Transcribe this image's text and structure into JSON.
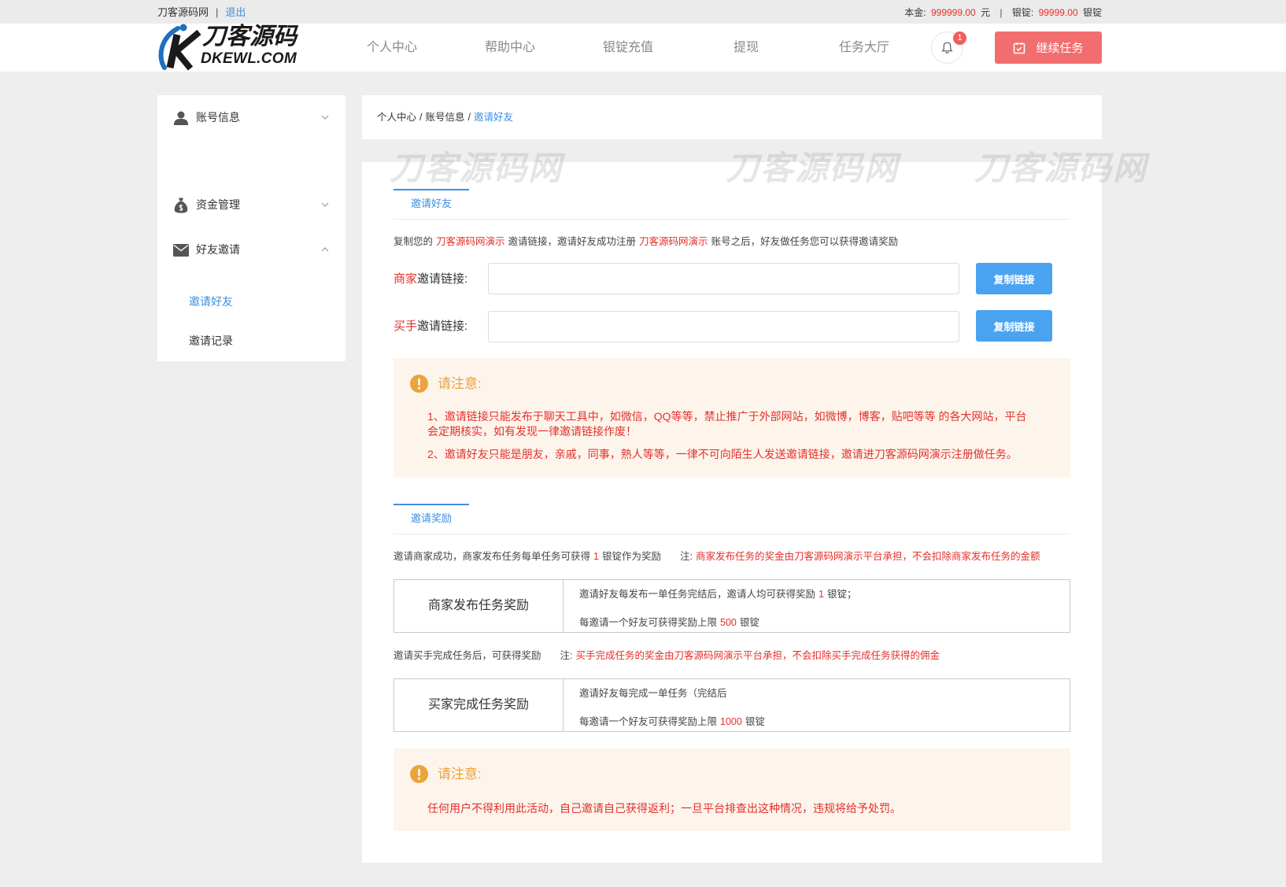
{
  "topbar": {
    "site_name": "刀客源码网",
    "separator": "|",
    "logout": "退出",
    "principal_label": "本金:",
    "principal_value": "999999.00",
    "principal_unit": "元",
    "ingot_label": "银锭:",
    "ingot_value": "99999.00",
    "ingot_unit": "银锭"
  },
  "header": {
    "logo": {
      "title": "刀客源码",
      "domain": "DKEWL.COM"
    },
    "nav": [
      "个人中心",
      "帮助中心",
      "银锭充值",
      "提现",
      "任务大厅"
    ],
    "notification_icon": "bell-icon",
    "notification_badge": "1",
    "continue_button": {
      "label": "继续任务",
      "icon": "calendar-check-icon"
    }
  },
  "sidebar": {
    "groups": [
      {
        "label": "账号信息",
        "icon": "user-icon",
        "expanded": false
      },
      {
        "label": "资金管理",
        "icon": "money-bag-icon",
        "expanded": false
      },
      {
        "label": "好友邀请",
        "icon": "envelope-icon",
        "expanded": true,
        "items": [
          {
            "label": "邀请好友",
            "active": true
          },
          {
            "label": "邀请记录",
            "active": false
          }
        ]
      }
    ]
  },
  "breadcrumb": {
    "items": [
      "个人中心",
      "账号信息",
      "邀请好友"
    ],
    "separator": "/"
  },
  "watermark": "刀客源码网",
  "invite": {
    "tab": "邀请好友",
    "intro": {
      "part1": "复制您的",
      "site1": "刀客源码网演示",
      "part2": "邀请链接，邀请好友成功注册",
      "site2": "刀客源码网演示",
      "part3": "账号之后，好友做任务您可以获得邀请奖励"
    },
    "merchant_link": {
      "label_highlight": "商家",
      "label_rest": "邀请链接:",
      "value": "",
      "copy_button": "复制链接"
    },
    "buyer_link": {
      "label_highlight": "买手",
      "label_rest": "邀请链接:",
      "value": "",
      "copy_button": "复制链接"
    },
    "notice": {
      "icon": "warning-icon",
      "title": "请注意:",
      "lines": [
        "1、邀请链接只能发布于聊天工具中，如微信，QQ等等，禁止推广于外部网站，如微博，博客，贴吧等等 的各大网站，平台",
        "会定期核实，如有发现一律邀请链接作废！",
        "2、邀请好友只能是朋友，亲戚，同事，熟人等等，一律不可向陌生人发送邀请链接，邀请进刀客源码网演示注册做任务。"
      ]
    }
  },
  "rewards": {
    "tab": "邀请奖励",
    "merchant_intro": {
      "text": "邀请商家成功，商家发布任务每单任务可获得",
      "amount": "1",
      "suffix": "银锭作为奖励",
      "note_label": "注:",
      "note": "商家发布任务的奖金由刀客源码网演示平台承担，不会扣除商家发布任务的金额"
    },
    "merchant_table": {
      "title": "商家发布任务奖励",
      "line1": {
        "text": "邀请好友每发布一单任务完结后，邀请人均可获得奖励",
        "amount": "1",
        "suffix": "银锭；"
      },
      "line2": {
        "text": "每邀请一个好友可获得奖励上限",
        "amount": "500",
        "suffix": "银锭"
      }
    },
    "buyer_intro": {
      "text": "邀请买手完成任务后，可获得奖励",
      "note_label": "注:",
      "note": "买手完成任务的奖金由刀客源码网演示平台承担，不会扣除买手完成任务获得的佣金"
    },
    "buyer_table": {
      "title": "买家完成任务奖励",
      "line1": {
        "text": "邀请好友每完成一单任务（完结后"
      },
      "line2": {
        "text": "每邀请一个好友可获得奖励上限",
        "amount": "1000",
        "suffix": "银锭"
      }
    },
    "notice": {
      "icon": "warning-icon",
      "title": "请注意:",
      "text": "任何用户不得利用此活动，自己邀请自己获得返利；一旦平台排查出这种情况，违规将给予处罚。"
    }
  },
  "colors": {
    "page_bg": "#eeeeee",
    "link_blue": "#3d8fe0",
    "button_blue": "#4aa3f0",
    "highlight_red": "#e3302b",
    "continue_red": "#f26e6e",
    "notice_bg": "#fdf5ec",
    "notice_orange": "#eca33c"
  }
}
